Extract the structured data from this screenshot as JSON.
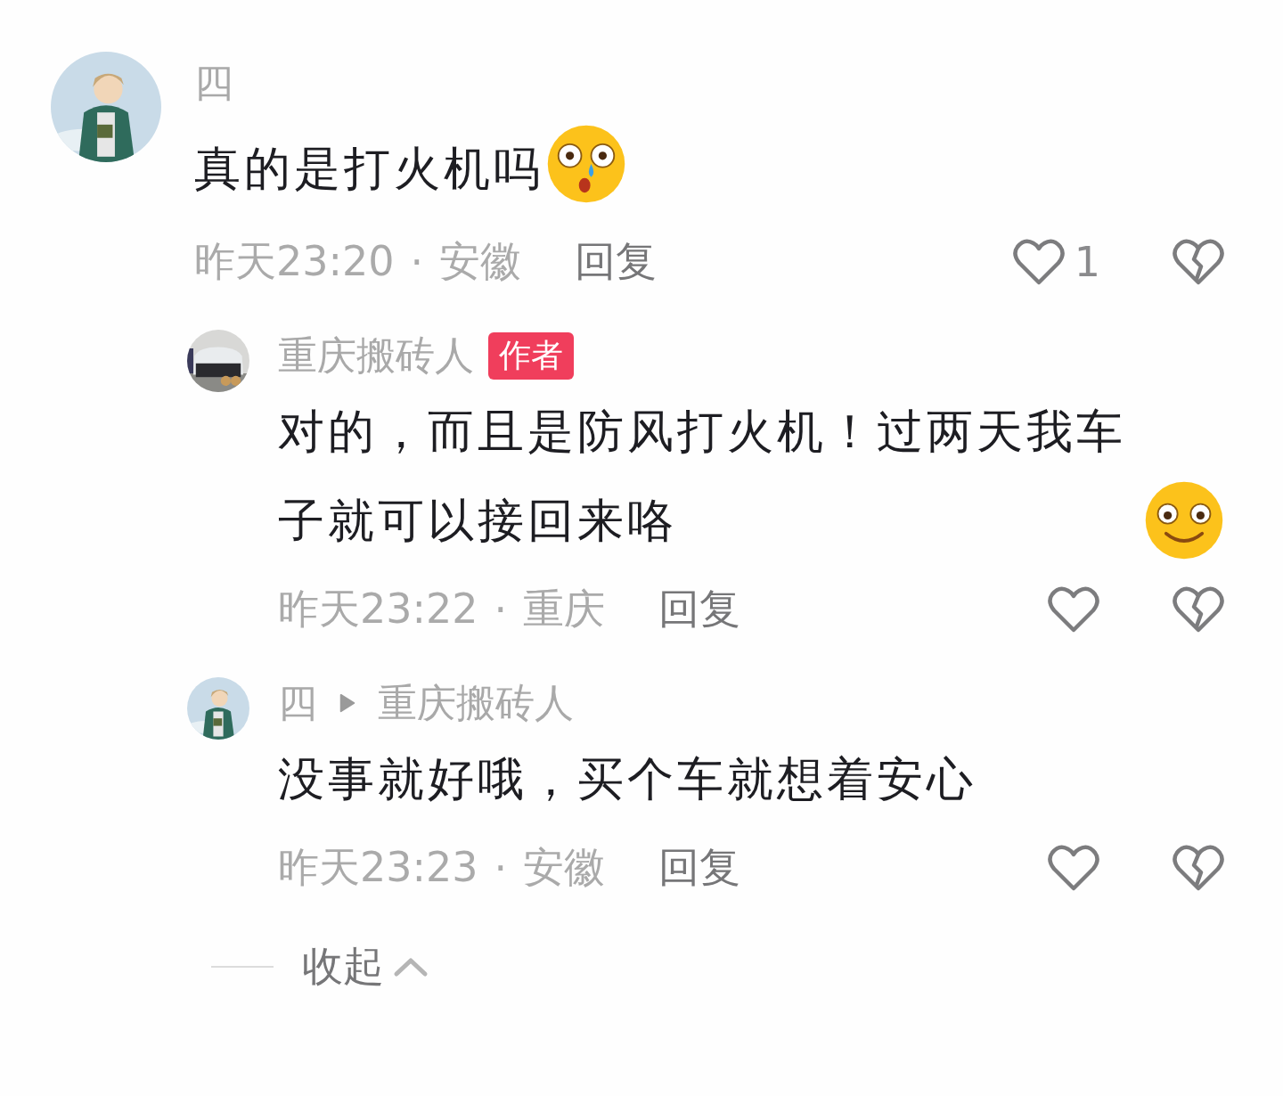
{
  "comments": [
    {
      "kind": "comment",
      "author": "四",
      "text": "真的是打火机吗",
      "emoji": {
        "kind": "surprised"
      },
      "time": "昨天23:20",
      "dot": "·",
      "location": "安徽",
      "reply_label": "回复",
      "likes": "1"
    },
    {
      "kind": "reply",
      "author": "重庆搬砖人",
      "badge": "作者",
      "text": "对的，而且是防风打火机！过两天我车子就可以接回来咯",
      "emoji": {
        "kind": "smiling"
      },
      "time": "昨天23:22",
      "dot": "·",
      "location": "重庆",
      "reply_label": "回复"
    },
    {
      "kind": "reply",
      "author": "四",
      "reply_to": "重庆搬砖人",
      "text": "没事就好哦，买个车就想着安心",
      "time": "昨天23:23",
      "dot": "·",
      "location": "安徽",
      "reply_label": "回复"
    }
  ],
  "collapse": {
    "label": "收起"
  }
}
